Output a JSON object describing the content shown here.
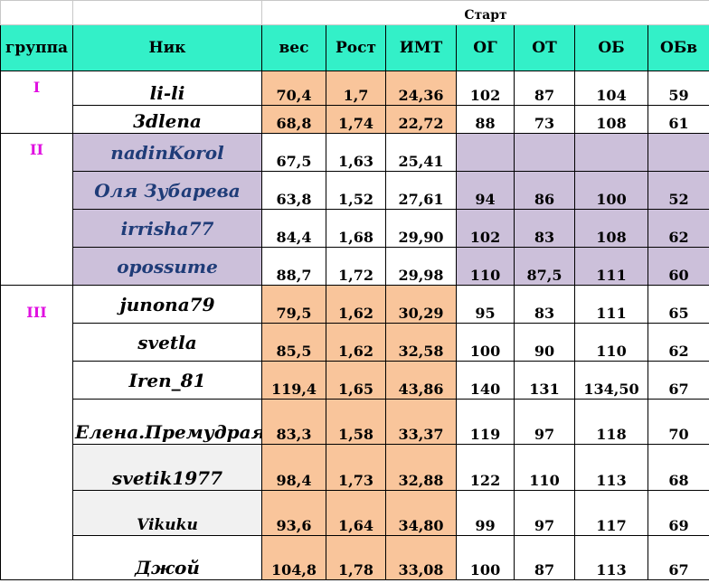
{
  "header": {
    "start_label": "Старт",
    "columns": [
      "группа",
      "Ник",
      "вес",
      "Рост",
      "ИМТ",
      "ОГ",
      "ОТ",
      "ОБ",
      "ОБв"
    ]
  },
  "groups": [
    {
      "label": "I",
      "rows": [
        {
          "nick": "li-li",
          "values": [
            "70,4",
            "1,7",
            "24,36",
            "102",
            "87",
            "104",
            "59"
          ]
        },
        {
          "nick": "3dlena",
          "values": [
            "68,8",
            "1,74",
            "22,72",
            "88",
            "73",
            "108",
            "61"
          ]
        }
      ]
    },
    {
      "label": "II",
      "rows": [
        {
          "nick": "nadinKorol",
          "values": [
            "67,5",
            "1,63",
            "25,41",
            "",
            "",
            "",
            ""
          ]
        },
        {
          "nick": "Оля Зубарева",
          "values": [
            "63,8",
            "1,52",
            "27,61",
            "94",
            "86",
            "100",
            "52"
          ]
        },
        {
          "nick": "irrisha77",
          "values": [
            "84,4",
            "1,68",
            "29,90",
            "102",
            "83",
            "108",
            "62"
          ]
        },
        {
          "nick": "opossume",
          "values": [
            "88,7",
            "1,72",
            "29,98",
            "110",
            "87,5",
            "111",
            "60"
          ]
        }
      ]
    },
    {
      "label": "III",
      "rows": [
        {
          "nick": "junona79",
          "values": [
            "79,5",
            "1,62",
            "30,29",
            "95",
            "83",
            "111",
            "65"
          ]
        },
        {
          "nick": "svetla",
          "values": [
            "85,5",
            "1,62",
            "32,58",
            "100",
            "90",
            "110",
            "62"
          ]
        },
        {
          "nick": "Iren_81",
          "values": [
            "119,4",
            "1,65",
            "43,86",
            "140",
            "131",
            "134,50",
            "67"
          ]
        },
        {
          "nick": "Елена.Премудрая",
          "values": [
            "83,3",
            "1,58",
            "33,37",
            "119",
            "97",
            "118",
            "70"
          ]
        },
        {
          "nick": "svetik1977",
          "values": [
            "98,4",
            "1,73",
            "32,88",
            "122",
            "110",
            "113",
            "68"
          ]
        },
        {
          "nick": "Vikuku",
          "values": [
            "93,6",
            "1,64",
            "34,80",
            "99",
            "97",
            "117",
            "69"
          ]
        },
        {
          "nick": "Джой",
          "values": [
            "104,8",
            "1,78",
            "33,08",
            "100",
            "87",
            "113",
            "67"
          ]
        }
      ]
    }
  ],
  "colors": {
    "header_bg": "#33f0c8",
    "peach": "#f9c59b",
    "lavender": "#ccc0da",
    "group_label": "#e010e0",
    "nick_blue": "#1f3c78"
  }
}
